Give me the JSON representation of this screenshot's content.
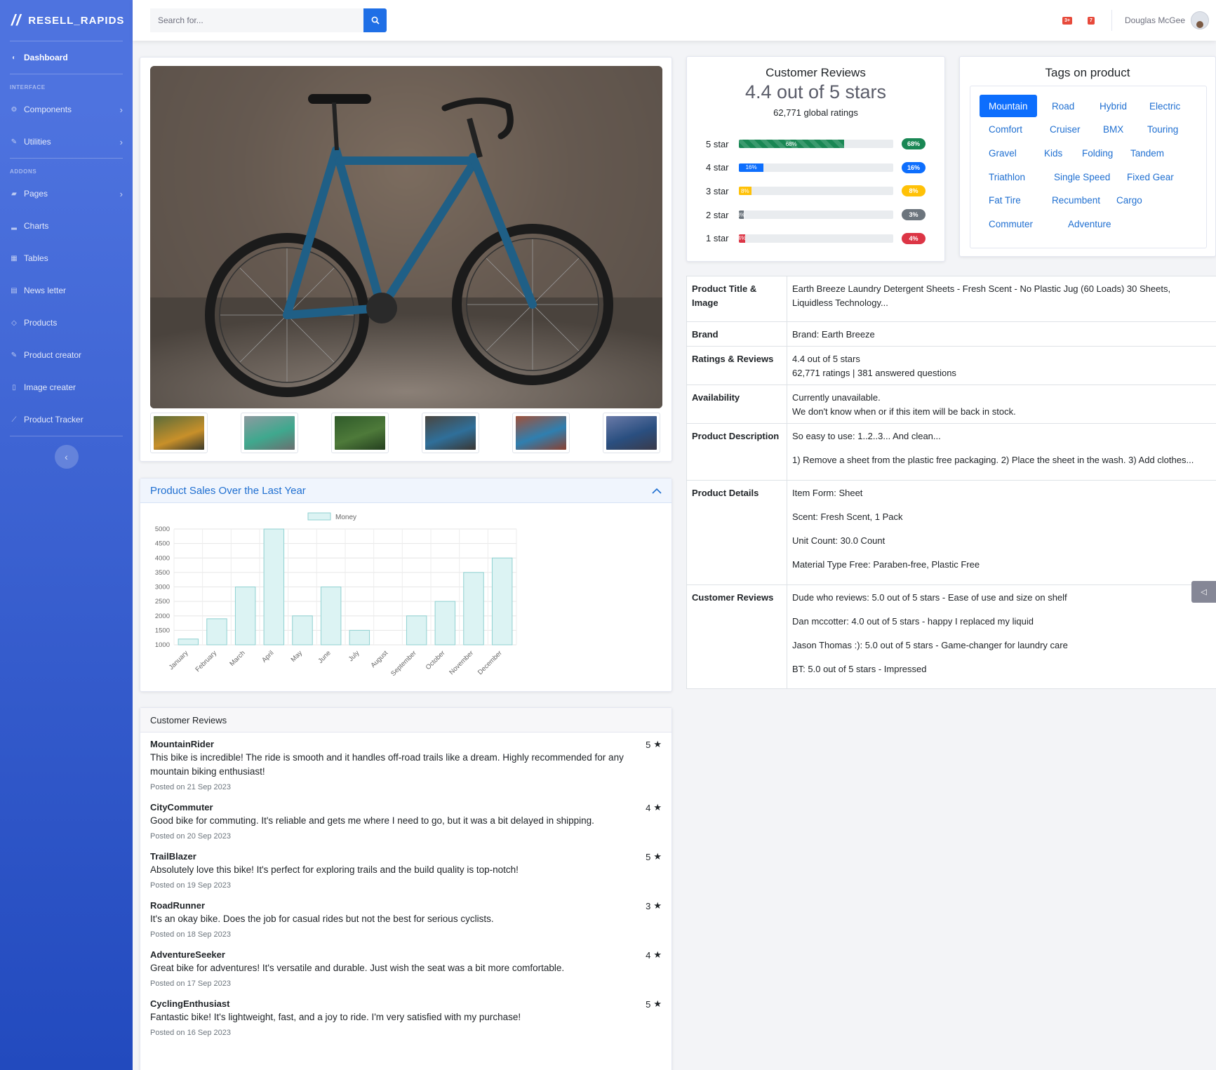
{
  "brand": {
    "name": "RESELL_RAPIDS",
    "icon": "slashes-icon"
  },
  "sidebar": {
    "dashboard": "Dashboard",
    "heading_interface": "INTERFACE",
    "components": "Components",
    "utilities": "Utilities",
    "heading_addons": "ADDONS",
    "items": [
      "Pages",
      "Charts",
      "Tables",
      "News letter",
      "Products",
      "Product creator",
      "Image creater",
      "Product Tracker"
    ]
  },
  "topbar": {
    "search_placeholder": "Search for...",
    "alerts_badge": "3+",
    "messages_badge": "7",
    "user_name": "Douglas McGee"
  },
  "colors": {
    "primary": "#4e73df",
    "accent": "#0d6efd",
    "success": "#198754",
    "warning": "#ffc107",
    "secondary": "#6c757d",
    "danger": "#dc3545"
  },
  "chart_card": {
    "title": "Product Sales Over the Last Year"
  },
  "chart_data": {
    "type": "bar",
    "categories": [
      "January",
      "February",
      "March",
      "April",
      "May",
      "June",
      "July",
      "August",
      "September",
      "October",
      "November",
      "December"
    ],
    "series": [
      {
        "name": "Money",
        "values": [
          1200,
          1900,
          3000,
          5000,
          2000,
          3000,
          1500,
          1000,
          2000,
          2500,
          3500,
          4000
        ]
      }
    ],
    "yticks": [
      1000,
      1500,
      2000,
      2500,
      3000,
      3500,
      4000,
      4500,
      5000
    ],
    "ylim": [
      1000,
      5000
    ],
    "legend": "top",
    "grid": true
  },
  "reviews": {
    "title": "Customer Reviews",
    "items": [
      {
        "user": "MountainRider",
        "rating": "5",
        "text": "This bike is incredible! The ride is smooth and it handles off-road trails like a dream. Highly recommended for any mountain biking enthusiast!",
        "date": "Posted on 21 Sep 2023"
      },
      {
        "user": "CityCommuter",
        "rating": "4",
        "text": "Good bike for commuting. It's reliable and gets me where I need to go, but it was a bit delayed in shipping.",
        "date": "Posted on 20 Sep 2023"
      },
      {
        "user": "TrailBlazer",
        "rating": "5",
        "text": "Absolutely love this bike! It's perfect for exploring trails and the build quality is top-notch!",
        "date": "Posted on 19 Sep 2023"
      },
      {
        "user": "RoadRunner",
        "rating": "3",
        "text": "It's an okay bike. Does the job for casual rides but not the best for serious cyclists.",
        "date": "Posted on 18 Sep 2023"
      },
      {
        "user": "AdventureSeeker",
        "rating": "4",
        "text": "Great bike for adventures! It's versatile and durable. Just wish the seat was a bit more comfortable.",
        "date": "Posted on 17 Sep 2023"
      },
      {
        "user": "CyclingEnthusiast",
        "rating": "5",
        "text": "Fantastic bike! It's lightweight, fast, and a joy to ride. I'm very satisfied with my purchase!",
        "date": "Posted on 16 Sep 2023"
      }
    ]
  },
  "ratings": {
    "title": "Customer Reviews",
    "summary": "4.4 out of 5 stars",
    "global": "62,771 global ratings",
    "bars": [
      {
        "label": "5 star",
        "percent": 68,
        "text": "68%",
        "color": "#198754",
        "striped": true
      },
      {
        "label": "4 star",
        "percent": 16,
        "text": "16%",
        "color": "#0d6efd",
        "striped": false
      },
      {
        "label": "3 star",
        "percent": 8,
        "text": "8%",
        "color": "#ffc107",
        "striped": false
      },
      {
        "label": "2 star",
        "percent": 3,
        "text": "3%",
        "color": "#6c757d",
        "striped": false
      },
      {
        "label": "1 star",
        "percent": 4,
        "text": "4%",
        "color": "#dc3545",
        "striped": false
      }
    ]
  },
  "tags": {
    "title": "Tags on product",
    "rows": [
      [
        "Mountain",
        "Road",
        "Hybrid",
        "Electric"
      ],
      [
        "Comfort",
        "Cruiser",
        "BMX",
        "Touring"
      ],
      [
        "Gravel",
        "Kids",
        "Folding",
        "Tandem"
      ],
      [
        "Triathlon",
        "Single Speed",
        "Fixed Gear"
      ],
      [
        "Fat Tire",
        "Recumbent",
        "Cargo"
      ],
      [
        "Commuter",
        "Adventure"
      ]
    ],
    "selected": "Mountain"
  },
  "details": {
    "title_label": "Product Title & Image",
    "title_value": "Earth Breeze Laundry Detergent Sheets - Fresh Scent - No Plastic Jug (60 Loads) 30 Sheets, Liquidless Technology...",
    "brand_label": "Brand",
    "brand_value": "Brand: Earth Breeze",
    "ratings_label": "Ratings & Reviews",
    "ratings_line1": "4.4 out of 5 stars",
    "ratings_line2": "62,771 ratings | 381 answered questions",
    "availability_label": "Availability",
    "availability_line1": "Currently unavailable.",
    "availability_line2": "We don't know when or if this item will be back in stock.",
    "description_label": "Product Description",
    "description_line1": "So easy to use: 1..2..3... And clean...",
    "description_line2": "1) Remove a sheet from the plastic free packaging. 2) Place the sheet in the wash. 3) Add clothes...",
    "product_details_label": "Product Details",
    "product_details": [
      "Item Form: Sheet",
      "Scent: Fresh Scent, 1 Pack",
      "Unit Count: 30.0 Count",
      "Material Type Free: Paraben-free, Plastic Free"
    ],
    "customer_reviews_label": "Customer Reviews",
    "customer_reviews": [
      "Dude who reviews: 5.0 out of 5 stars - Ease of use and size on shelf",
      "Dan mccotter: 4.0 out of 5 stars - happy I replaced my liquid",
      "Jason Thomas :): 5.0 out of 5 stars - Game-changer for laundry care",
      "BT: 5.0 out of 5 stars - Impressed"
    ]
  }
}
